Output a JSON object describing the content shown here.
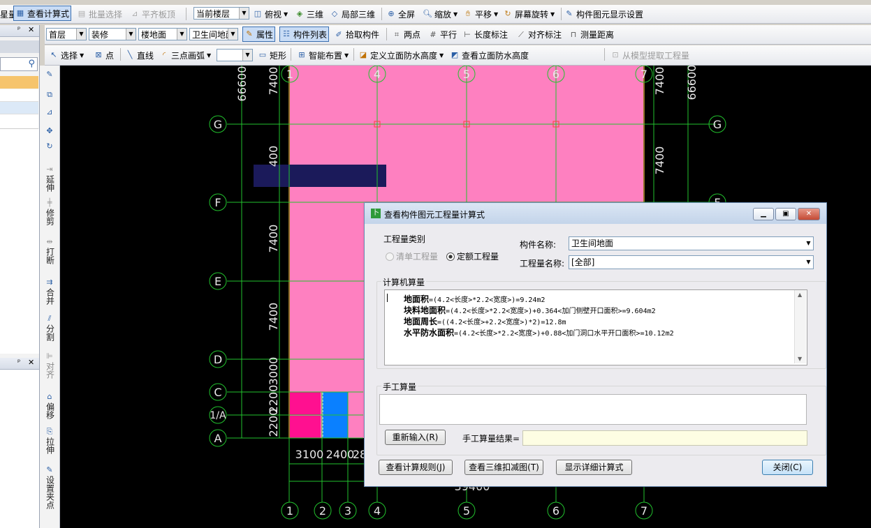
{
  "toolbar1": {
    "left_cut": "星量",
    "view_calc": "查看计算式",
    "batch_select": "批量选择",
    "align_top": "平齐板顶",
    "floor_scope": "当前楼层",
    "top_view": "俯视",
    "three_d": "三维",
    "local_3d": "局部三维",
    "fullscreen": "全屏",
    "zoom": "缩放",
    "pan": "平移",
    "rotate": "屏幕旋转",
    "display_settings": "构件图元显示设置"
  },
  "toolbar2": {
    "floor": "首层",
    "category": "装修",
    "type": "楼地面",
    "component": "卫生间地面",
    "properties": "属性",
    "component_list": "构件列表",
    "pick": "拾取构件",
    "two_points": "两点",
    "parallel": "平行",
    "length_dim": "长度标注",
    "align_dim": "对齐标注",
    "measure": "测量距离"
  },
  "toolbar3": {
    "select": "选择",
    "point": "点",
    "line": "直线",
    "arc": "三点画弧",
    "rect": "矩形",
    "smart": "智能布置",
    "define_wp": "定义立面防水高度",
    "view_wp": "查看立面防水高度",
    "extract": "从模型提取工程量"
  },
  "vertical_tools": [
    "延伸",
    "修剪",
    "打断",
    "合并",
    "分割",
    "对齐",
    "偏移",
    "拉伸",
    "设置夹点"
  ],
  "grid": {
    "columns_bottom": [
      "1",
      "2",
      "3",
      "4",
      "5",
      "6",
      "7"
    ],
    "columns_top": [
      "1",
      "4",
      "5",
      "6",
      "7"
    ],
    "rows": [
      "G",
      "F",
      "E",
      "D",
      "C",
      "1/A",
      "A"
    ],
    "dims_left": [
      "66600",
      "7400",
      "400",
      "7400",
      "7400",
      "3000",
      "2200",
      "2200"
    ],
    "dims_right": [
      "7400",
      "66600",
      "7400"
    ],
    "dims_bottom": [
      "3100",
      "2400",
      "28",
      "39400"
    ]
  },
  "dialog": {
    "title": "查看构件图元工程量计算式",
    "qty_category_label": "工程量类别",
    "radio_list": "清单工程量",
    "radio_quota": "定额工程量",
    "component_name_label": "构件名称:",
    "component_name_value": "卫生间地面",
    "qty_name_label": "工程量名称:",
    "qty_name_value": "[全部]",
    "machine_calc_label": "计算机算量",
    "calc_lines": [
      {
        "name": "地面积",
        "formula": "=(4.2<长度>*2.2<宽度>)=9.24m2"
      },
      {
        "name": "块料地面积",
        "formula": "=(4.2<长度>*2.2<宽度>)+0.364<加门侧壁开口面积>=9.604m2"
      },
      {
        "name": "地面周长",
        "formula": "=((4.2<长度>+2.2<宽度>)*2)=12.8m"
      },
      {
        "name": "水平防水面积",
        "formula": "=(4.2<长度>*2.2<宽度>)+0.88<加门洞口水平开口面积>=10.12m2"
      }
    ],
    "manual_label": "手工算量",
    "reenter_button": "重新输入(R)",
    "manual_result_label": "手工算量结果=",
    "manual_result_value": "",
    "view_rules_button": "查看计算规则(J)",
    "view_3d_button": "查看三维扣减图(T)",
    "show_detail_button": "显示详细计算式",
    "close_button": "关闭(C)"
  },
  "colors": {
    "room_fill": "#fe80c0",
    "grid_line": "#22c22e",
    "wall_red": "#ff2020",
    "dark_bar": "#1b1a5a",
    "blue_room": "#0a80ff",
    "magenta_room": "#ff1090"
  }
}
